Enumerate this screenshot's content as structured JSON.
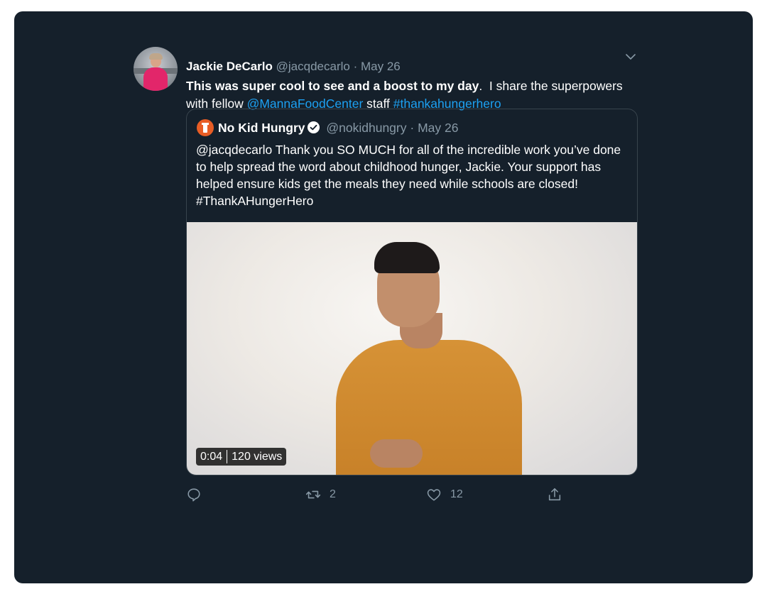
{
  "tweet": {
    "author_name": "Jackie DeCarlo",
    "author_handle": "@jacqdecarlo",
    "separator": "·",
    "date": "May 26",
    "text_bold": "This was super cool to see and a boost to my day",
    "text_period": ".",
    "text_mid": "  I share the superpowers with fellow ",
    "mention": "@MannaFoodCenter",
    "text_after_mention": " staff ",
    "hashtag": "#thankahungerhero"
  },
  "quoted": {
    "author_name": "No Kid Hungry",
    "author_handle": "@nokidhungry",
    "separator": "·",
    "date": "May 26",
    "text": "@jacqdecarlo Thank you SO MUCH for all of the incredible work you’ve done to help spread the word about childhood hunger, Jackie. Your support has helped ensure kids get the meals they need while schools are closed! #ThankAHungerHero",
    "video": {
      "duration": "0:04",
      "views": "120 views"
    }
  },
  "actions": {
    "reply_count": "",
    "retweet_count": "2",
    "like_count": "12"
  },
  "icons": {
    "menu": "chevron-down-icon",
    "verified": "verified-badge-icon",
    "reply": "reply-icon",
    "retweet": "retweet-icon",
    "like": "heart-icon",
    "share": "share-icon"
  },
  "colors": {
    "background": "#15202b",
    "text": "#ffffff",
    "secondary": "#8899a6",
    "link": "#1da1f2",
    "border": "#38444d",
    "brand_logo": "#e85d25"
  }
}
